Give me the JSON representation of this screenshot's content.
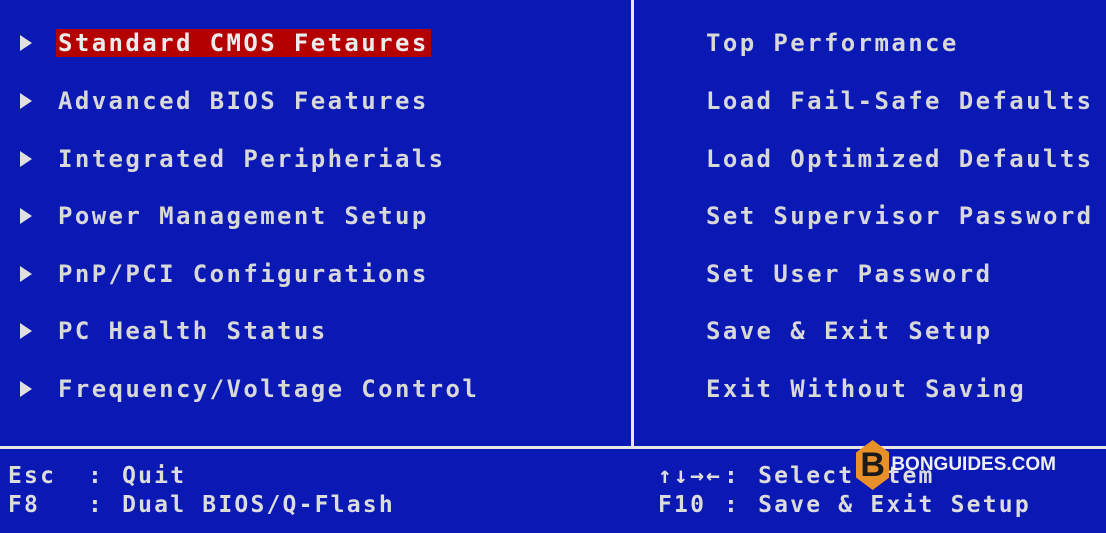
{
  "left_menu": [
    {
      "label": "Standard CMOS Fetaures",
      "selected": true
    },
    {
      "label": "Advanced BIOS Features",
      "selected": false
    },
    {
      "label": "Integrated Peripherials",
      "selected": false
    },
    {
      "label": "Power Management Setup",
      "selected": false
    },
    {
      "label": "PnP/PCI Configurations",
      "selected": false
    },
    {
      "label": "PC Health Status",
      "selected": false
    },
    {
      "label": "Frequency/Voltage Control",
      "selected": false
    }
  ],
  "right_menu": [
    {
      "label": "Top Performance"
    },
    {
      "label": "Load Fail-Safe Defaults"
    },
    {
      "label": "Load Optimized Defaults"
    },
    {
      "label": "Set Supervisor Password"
    },
    {
      "label": "Set User Password"
    },
    {
      "label": "Save & Exit Setup"
    },
    {
      "label": "Exit Without Saving"
    }
  ],
  "footer": {
    "left": [
      {
        "key": "Esc",
        "sep": ":",
        "action": "Quit"
      },
      {
        "key": "F8",
        "sep": ":",
        "action": "Dual BIOS/Q-Flash"
      }
    ],
    "right": [
      {
        "key": "↑↓→←",
        "sep": ":",
        "action": "Select Item"
      },
      {
        "key": "F10",
        "sep": ":",
        "action": "Save & Exit Setup"
      }
    ]
  },
  "watermark": {
    "logo_letter": "B",
    "text": "BONGUIDES.COM"
  },
  "colors": {
    "background": "#0a18b4",
    "highlight": "#b40000",
    "text": "#d8d8d8",
    "watermark_orange": "#e8912a"
  }
}
